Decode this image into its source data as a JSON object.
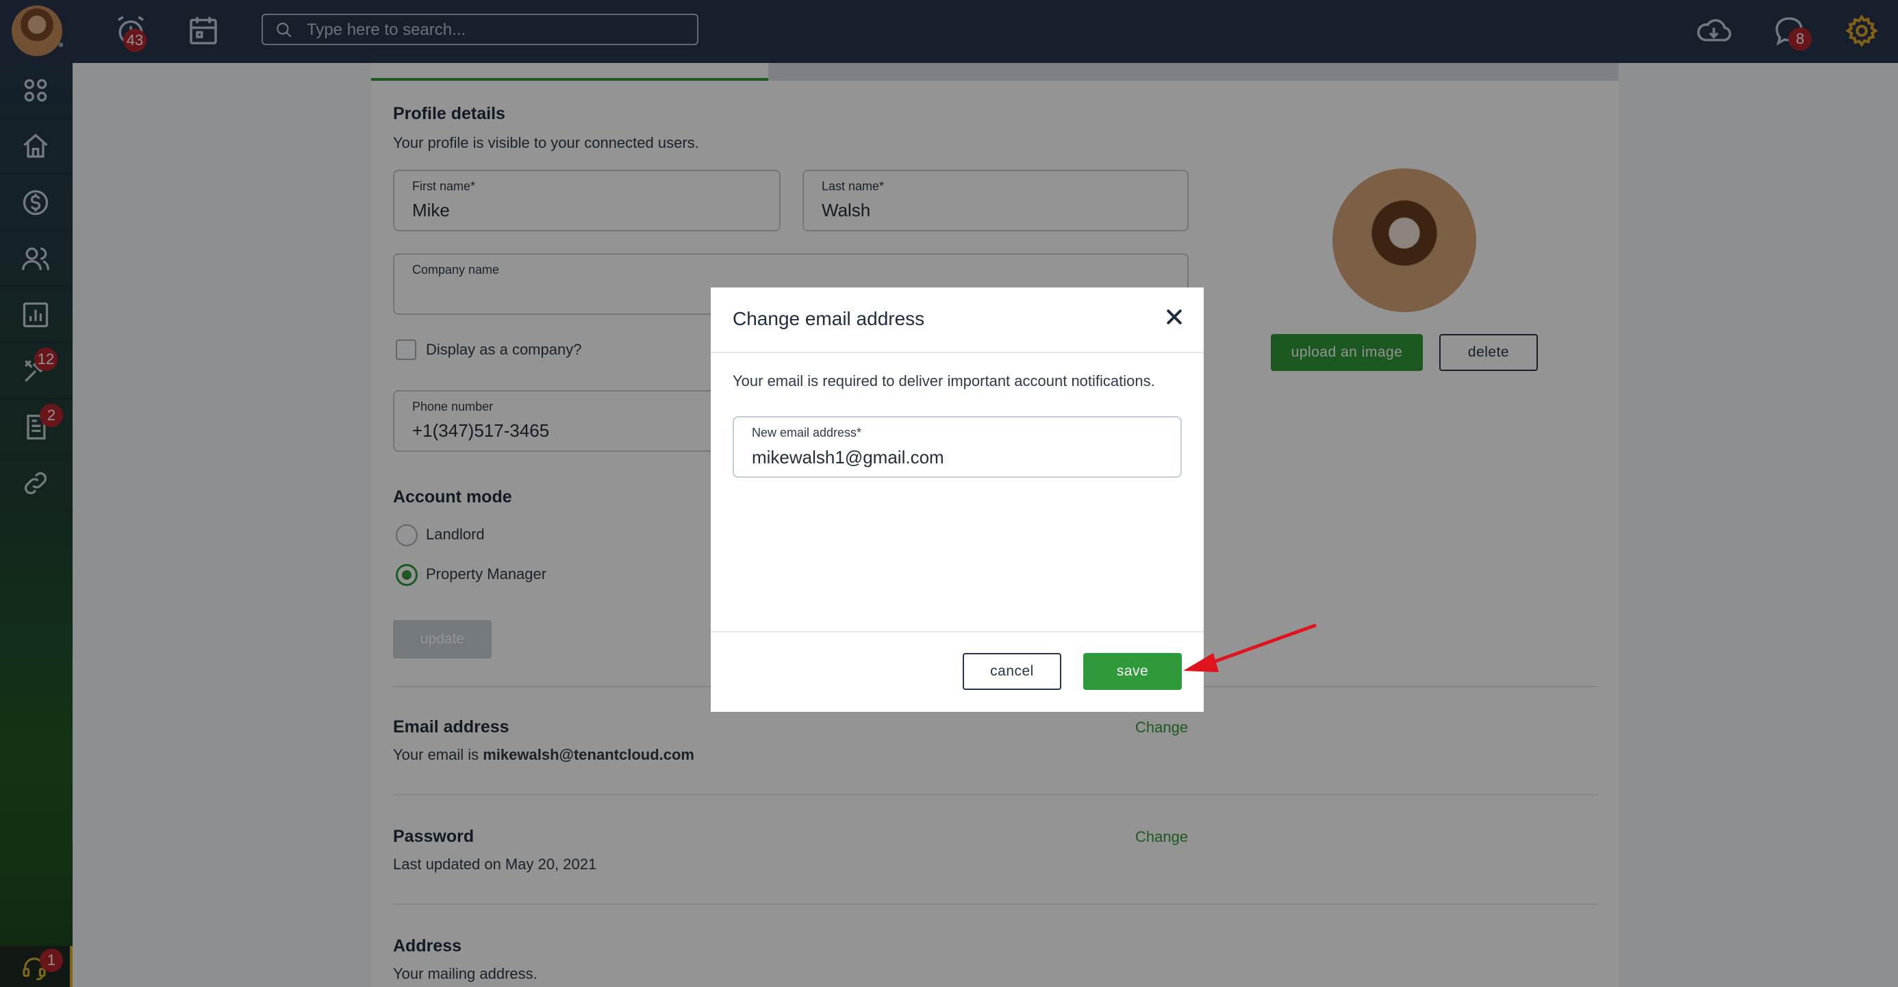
{
  "topbar": {
    "notifications_count": "43",
    "search_placeholder": "Type here to search...",
    "messages_count": "8"
  },
  "sidebar": {
    "tools_count": "12",
    "documents_count": "2",
    "support_count": "1"
  },
  "profile": {
    "section_title": "Profile details",
    "section_subtitle": "Your profile is visible to your connected users.",
    "first_name_label": "First name*",
    "first_name_value": "Mike",
    "last_name_label": "Last name*",
    "last_name_value": "Walsh",
    "company_label": "Company name",
    "company_value": "",
    "display_company_label": "Display as a company?",
    "phone_label": "Phone number",
    "phone_value": "+1(347)517-3465",
    "upload_label": "upload an image",
    "delete_label": "delete"
  },
  "account_mode": {
    "title": "Account mode",
    "options": [
      "Landlord",
      "Property Manager"
    ],
    "selected": "Property Manager",
    "update_label": "update"
  },
  "email_section": {
    "title": "Email address",
    "text_prefix": "Your email is ",
    "email": "mikewalsh@tenantcloud.com",
    "change_label": "Change"
  },
  "password_section": {
    "title": "Password",
    "text": "Last updated on May 20, 2021",
    "change_label": "Change"
  },
  "address_section": {
    "title": "Address",
    "text": "Your mailing address."
  },
  "modal": {
    "title": "Change email address",
    "description": "Your email is required to deliver important account notifications.",
    "field_label": "New email address*",
    "field_value": "mikewalsh1@gmail.com",
    "cancel_label": "cancel",
    "save_label": "save"
  },
  "colors": {
    "topbar": "#27364a",
    "accent_green": "#2f9a3a",
    "badge_red": "#b3262d",
    "annotation_arrow": "#e0141e"
  }
}
